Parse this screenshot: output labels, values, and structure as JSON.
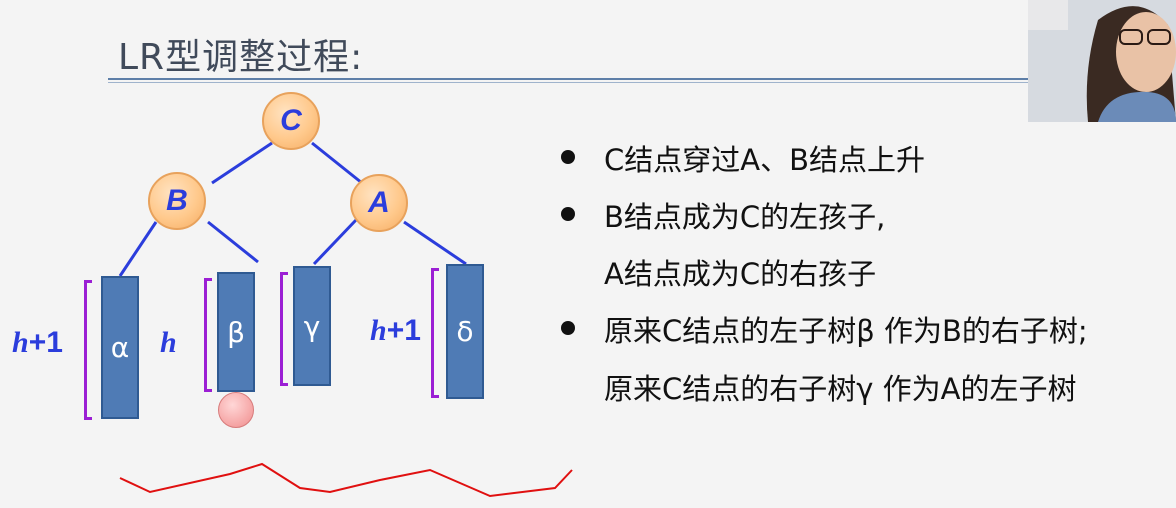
{
  "slide": {
    "title": "LR型调整过程:"
  },
  "tree": {
    "nodes": {
      "c": "C",
      "b": "B",
      "a": "A"
    },
    "subtrees": {
      "alpha": "α",
      "beta": "β",
      "gamma": "γ",
      "delta": "δ"
    },
    "heights": {
      "alpha": {
        "var": "h",
        "suffix": "+1"
      },
      "beta": {
        "var": "h",
        "suffix": ""
      },
      "delta": {
        "var": "h",
        "suffix": "+1"
      }
    }
  },
  "bullets": [
    {
      "lines": [
        "C结点穿过A、B结点上升"
      ]
    },
    {
      "lines": [
        "B结点成为C的左孩子,",
        "A结点成为C的右孩子"
      ]
    },
    {
      "lines": [
        "原来C结点的左子树β 作为B的右子树;",
        "原来C结点的右子树γ 作为A的左子树"
      ]
    }
  ],
  "colors": {
    "node_fill": "#ffc98c",
    "node_text": "#2b3ddc",
    "subtree_fill": "#4f7bb5",
    "bracket": "#9b1fd4",
    "annotation": "#e01010"
  }
}
